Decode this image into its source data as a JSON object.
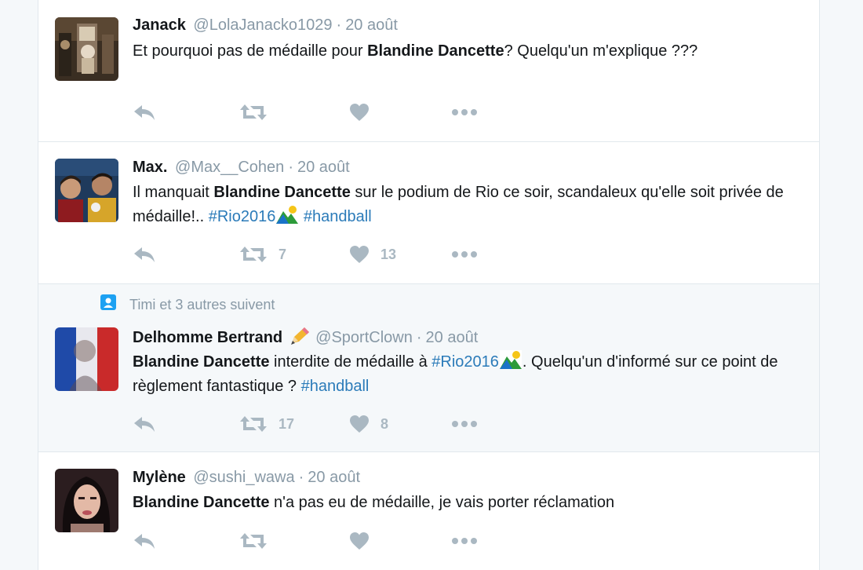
{
  "tweets": [
    {
      "name": "Janack",
      "handle": "@LolaJanacko1029",
      "time": "20 août",
      "text_before": "Et pourquoi pas de médaille pour ",
      "bold": "Blandine Dancette",
      "text_after": "? Quelqu'un m'explique ???",
      "retweets": "",
      "likes": ""
    },
    {
      "name": "Max.",
      "handle": "@Max__Cohen",
      "time": "20 août",
      "text_before": "Il manquait ",
      "bold": "Blandine Dancette",
      "text_after": " sur le podium de Rio ce soir, scandaleux qu'elle soit privée de médaille!.. ",
      "hashtag1": "#Rio2016",
      "hashtag2": "#handball",
      "retweets": "7",
      "likes": "13"
    },
    {
      "context": "Timi et 3 autres suivent",
      "name": "Delhomme Bertrand",
      "handle": "@SportClown",
      "time": "20 août",
      "bold": "Blandine Dancette",
      "text_mid": " interdite de médaille à ",
      "hashtag1": "#Rio2016",
      "text_after": ". Quelqu'un d'informé sur ce point de règlement fantastique ? ",
      "hashtag2": "#handball",
      "retweets": "17",
      "likes": "8"
    },
    {
      "name": "Mylène",
      "handle": "@sushi_wawa",
      "time": "20 août",
      "bold": "Blandine Dancette",
      "text_after": " n'a pas eu de médaille, je vais porter réclamation",
      "retweets": "",
      "likes": ""
    }
  ],
  "separator": "·",
  "colors": {
    "link": "#2b7bb9",
    "muted": "#8899a6",
    "icon": "#aab8c2",
    "follow_icon": "#1da1f2"
  },
  "icons": [
    "reply-icon",
    "retweet-icon",
    "like-icon",
    "more-icon",
    "pencil-emoji",
    "rio-olympics-emoji",
    "follow-context-icon"
  ]
}
